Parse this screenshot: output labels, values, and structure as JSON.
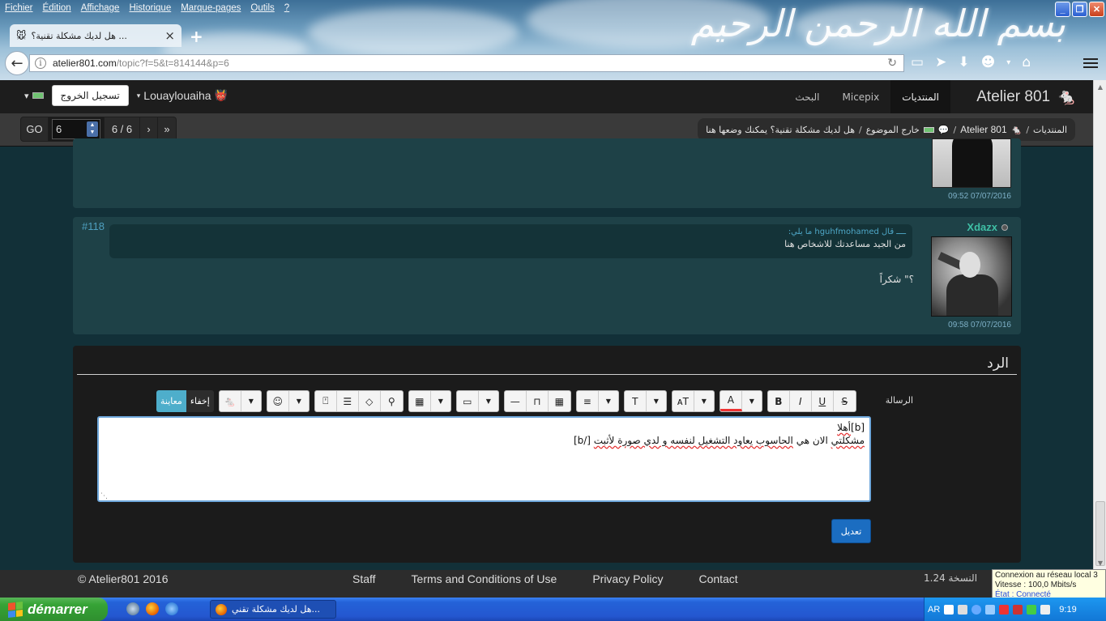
{
  "browser": {
    "menu": [
      "Fichier",
      "Édition",
      "Affichage",
      "Historique",
      "Marque-pages",
      "Outils",
      "?"
    ],
    "tab_title": "هل لديك مشكلة تقنية؟ ...",
    "url_domain": "atelier801.com",
    "url_path": "/topic?f=5&t=814144&p=6",
    "banner_text": "بسم الله الرحمن الرحيم"
  },
  "site": {
    "brand": "Atelier 801",
    "nav": [
      "المنتديات",
      "Micepix",
      "البحث"
    ],
    "username": "Louaylouaiha",
    "logout": "تسجيل الخروج"
  },
  "breadcrumb": {
    "forums": "المنتديات",
    "site": "Atelier 801",
    "section": "خارج الموضوع",
    "topic": "هل لديك مشكلة تقنية؟ يمكنك وضعها هنا"
  },
  "pager": {
    "go": "GO",
    "input_value": "6",
    "count": "6 / 6",
    "next": "›",
    "last": "»"
  },
  "posts": {
    "prev_date": "09:52 07/07/2016",
    "p118": {
      "number": "#118",
      "author": "Xdazx",
      "quote_header": "ــــ قال hguhfmohamed ما يلي:",
      "quote_text": "من الجيد مساعدتك للاشخاص هنا",
      "message": "؟\" شكراً",
      "date": "09:58 07/07/2016"
    }
  },
  "reply": {
    "title": "الرد",
    "message_label": "الرسالة",
    "preview": "معاينة",
    "hide": "إخفاء",
    "editor_line1_tag": "[b]",
    "editor_line1_word": "أهلا",
    "editor_line2_a": "مشكلتي",
    "editor_line2_b": " الان هي ",
    "editor_line2_c": "الحاسوب يعاود التشغيل لنفسه و لدي صورة لأثبت",
    "editor_line2_end": " [/b]",
    "send": "تعديل"
  },
  "toolbar_icons": [
    "strike-icon",
    "underline-icon",
    "italic-icon",
    "bold-icon",
    "color-icon",
    "font-size-icon",
    "font-icon",
    "align-icon",
    "table-icon",
    "spoiler-icon",
    "hr-icon",
    "image-icon",
    "video-icon",
    "code-icon",
    "quote-icon",
    "list-icon",
    "blockquote-icon",
    "emoji-icon",
    "mouse-icon"
  ],
  "footer": {
    "copyright": "© Atelier801 2016",
    "links": [
      "Staff",
      "Terms and Conditions of Use",
      "Privacy Policy",
      "Contact"
    ],
    "version": "النسخة 1.24"
  },
  "network_popup": {
    "line1": "Connexion au réseau local 3",
    "line2": "Vitesse : 100,0 Mbits/s",
    "line3": "État : Connecté"
  },
  "taskbar": {
    "start": "démarrer",
    "task": "هل لديك مشكلة تقني...",
    "lang": "AR",
    "time": "9:19"
  }
}
